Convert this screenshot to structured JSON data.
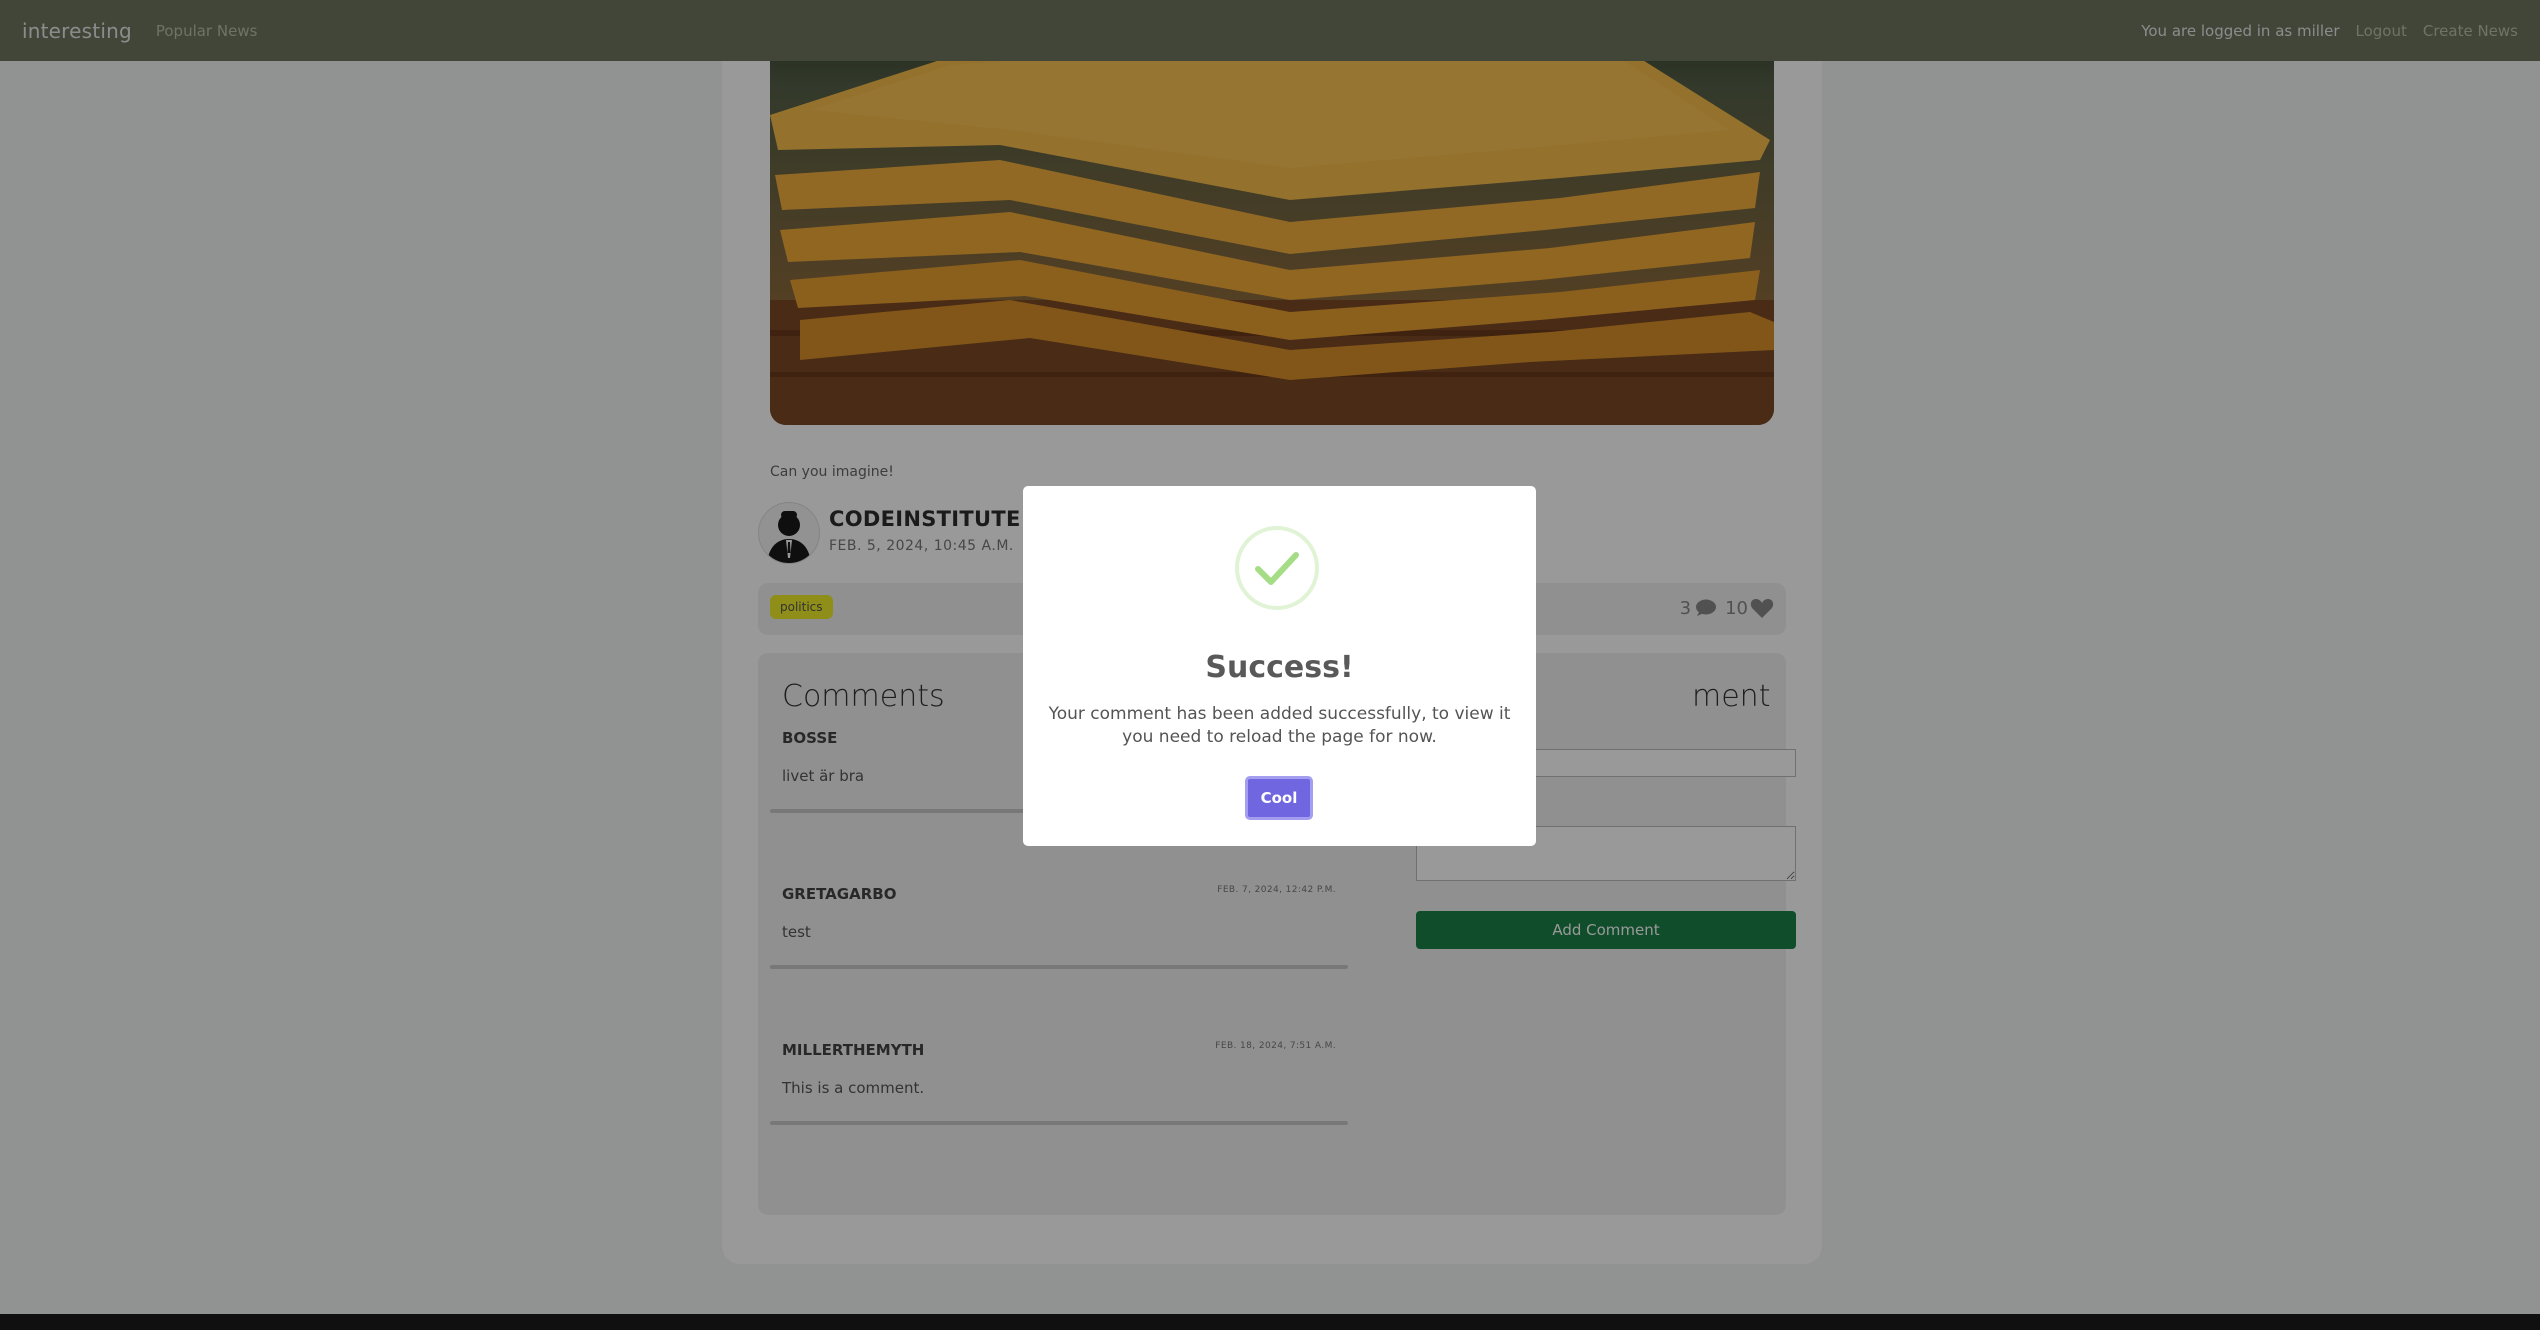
{
  "navbar": {
    "brand": "interesting",
    "popular": "Popular News",
    "logged_in": "You are logged in as miller",
    "logout": "Logout",
    "create": "Create News"
  },
  "post": {
    "caption": "Can you imagine!",
    "author": "CODEINSTITUTE",
    "date": "FEB. 5, 2024, 10:45 A.M.",
    "tag": "politics",
    "comment_count": "3",
    "like_count": "10"
  },
  "comments": {
    "title": "Comments",
    "items": [
      {
        "author": "BOSSE",
        "date": "",
        "text": "livet är bra"
      },
      {
        "author": "GRETAGARBO",
        "date": "FEB. 7, 2024, 12:42 P.M.",
        "text": "test"
      },
      {
        "author": "MILLERTHEMYTH",
        "date": "FEB. 18, 2024, 7:51 A.M.",
        "text": "This is a comment."
      }
    ]
  },
  "comment_form": {
    "title_fragment": "ment",
    "submit": "Add Comment"
  },
  "modal": {
    "title": "Success!",
    "message": "Your comment has been added successfully, to view it you need to reload the page for now.",
    "confirm": "Cool"
  },
  "colors": {
    "navbar": "#6e7560",
    "tag": "#eded2a",
    "add_button": "#1a8048",
    "confirm_button": "#7066e0",
    "success_check": "#a5dc86"
  }
}
